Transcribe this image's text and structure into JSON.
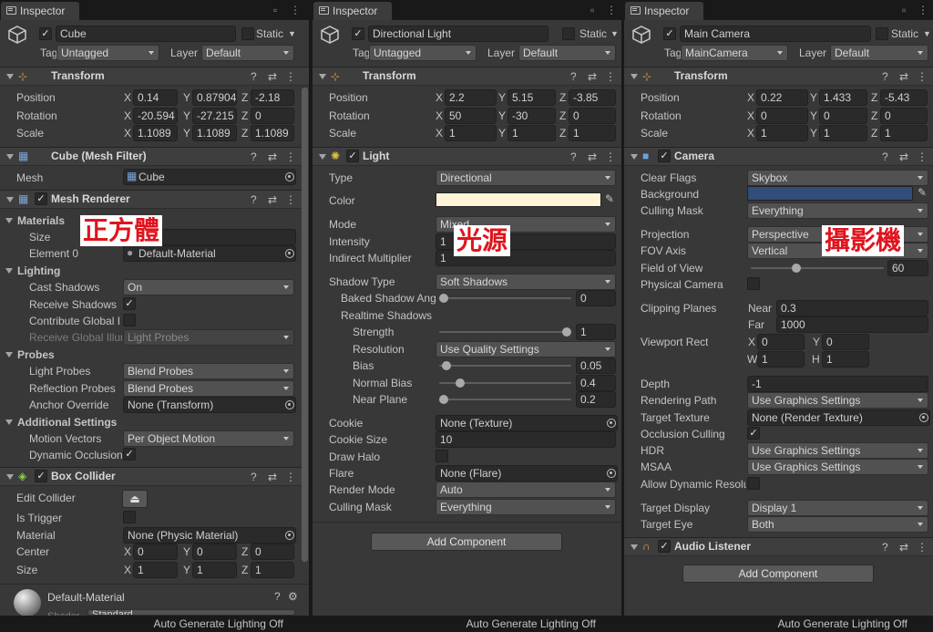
{
  "panel1": {
    "tab": "Inspector",
    "name": "Cube",
    "static_label": "Static",
    "tag_label": "Tag",
    "tag_value": "Untagged",
    "layer_label": "Layer",
    "layer_value": "Default",
    "transform": {
      "title": "Transform",
      "position_label": "Position",
      "rotation_label": "Rotation",
      "scale_label": "Scale",
      "position": [
        "0.14",
        "0.87904",
        "-2.18"
      ],
      "rotation": [
        "-20.594",
        "-27.215",
        "0"
      ],
      "scale": [
        "1.1089",
        "1.1089",
        "1.1089"
      ]
    },
    "mesh_filter": {
      "title": "Cube (Mesh Filter)",
      "mesh_label": "Mesh",
      "mesh_value": "Cube"
    },
    "mesh_renderer": {
      "title": "Mesh Renderer",
      "materials_label": "Materials",
      "size_label": "Size",
      "element0_label": "Element 0",
      "element0_value": "Default-Material",
      "lighting_label": "Lighting",
      "cast_shadows_label": "Cast Shadows",
      "cast_shadows_value": "On",
      "receive_shadows_label": "Receive Shadows",
      "contribute_gi_label": "Contribute Global Il",
      "receive_gi_label": "Receive Global Illur",
      "receive_gi_value": "Light Probes",
      "probes_label": "Probes",
      "light_probes_label": "Light Probes",
      "light_probes_value": "Blend Probes",
      "reflection_probes_label": "Reflection Probes",
      "reflection_probes_value": "Blend Probes",
      "anchor_override_label": "Anchor Override",
      "anchor_override_value": "None (Transform)",
      "additional_label": "Additional Settings",
      "motion_vectors_label": "Motion Vectors",
      "motion_vectors_value": "Per Object Motion",
      "dynamic_occlusion_label": "Dynamic Occlusion"
    },
    "box_collider": {
      "title": "Box Collider",
      "edit_collider_label": "Edit Collider",
      "is_trigger_label": "Is Trigger",
      "material_label": "Material",
      "material_value": "None (Physic Material)",
      "center_label": "Center",
      "center": [
        "0",
        "0",
        "0"
      ],
      "size_label": "Size",
      "size": [
        "1",
        "1",
        "1"
      ]
    },
    "material_preview": {
      "name": "Default-Material",
      "shader_label": "Shader",
      "shader_value": "Standard"
    },
    "overlay": "正方體",
    "footer": "Auto Generate Lighting Off"
  },
  "panel2": {
    "tab": "Inspector",
    "name": "Directional Light",
    "static_label": "Static",
    "tag_label": "Tag",
    "tag_value": "Untagged",
    "layer_label": "Layer",
    "layer_value": "Default",
    "transform": {
      "title": "Transform",
      "position_label": "Position",
      "rotation_label": "Rotation",
      "scale_label": "Scale",
      "position": [
        "2.2",
        "5.15",
        "-3.85"
      ],
      "rotation": [
        "50",
        "-30",
        "0"
      ],
      "scale": [
        "1",
        "1",
        "1"
      ]
    },
    "light": {
      "title": "Light",
      "type_label": "Type",
      "type_value": "Directional",
      "color_label": "Color",
      "color_value": "#fff4d6",
      "mode_label": "Mode",
      "mode_value": "Mixed",
      "intensity_label": "Intensity",
      "intensity_value": "1",
      "indirect_label": "Indirect Multiplier",
      "indirect_value": "1",
      "shadow_type_label": "Shadow Type",
      "shadow_type_value": "Soft Shadows",
      "baked_shadow_label": "Baked Shadow Ang",
      "baked_shadow_value": "0",
      "baked_shadow_fraction": 0.0,
      "realtime_label": "Realtime Shadows",
      "strength_label": "Strength",
      "strength_value": "1",
      "strength_fraction": 1.0,
      "resolution_label": "Resolution",
      "resolution_value": "Use Quality Settings",
      "bias_label": "Bias",
      "bias_value": "0.05",
      "bias_fraction": 0.025,
      "normal_bias_label": "Normal Bias",
      "normal_bias_value": "0.4",
      "normal_bias_fraction": 0.13,
      "near_plane_label": "Near Plane",
      "near_plane_value": "0.2",
      "near_plane_fraction": 0.0,
      "cookie_label": "Cookie",
      "cookie_value": "None (Texture)",
      "cookie_size_label": "Cookie Size",
      "cookie_size_value": "10",
      "draw_halo_label": "Draw Halo",
      "flare_label": "Flare",
      "flare_value": "None (Flare)",
      "render_mode_label": "Render Mode",
      "render_mode_value": "Auto",
      "culling_mask_label": "Culling Mask",
      "culling_mask_value": "Everything"
    },
    "add_component": "Add Component",
    "overlay": "光源",
    "footer": "Auto Generate Lighting Off"
  },
  "panel3": {
    "tab": "Inspector",
    "name": "Main Camera",
    "static_label": "Static",
    "tag_label": "Tag",
    "tag_value": "MainCamera",
    "layer_label": "Layer",
    "layer_value": "Default",
    "transform": {
      "title": "Transform",
      "position_label": "Position",
      "rotation_label": "Rotation",
      "scale_label": "Scale",
      "position": [
        "0.22",
        "1.433",
        "-5.43"
      ],
      "rotation": [
        "0",
        "0",
        "0"
      ],
      "scale": [
        "1",
        "1",
        "1"
      ]
    },
    "camera": {
      "title": "Camera",
      "clear_flags_label": "Clear Flags",
      "clear_flags_value": "Skybox",
      "background_label": "Background",
      "background_color": "#314d79",
      "culling_mask_label": "Culling Mask",
      "culling_mask_value": "Everything",
      "projection_label": "Projection",
      "projection_value": "Perspective",
      "fov_axis_label": "FOV Axis",
      "fov_axis_value": "Vertical",
      "fov_label": "Field of View",
      "fov_value": "60",
      "fov_fraction": 0.33,
      "physical_label": "Physical Camera",
      "clipping_label": "Clipping Planes",
      "near_label": "Near",
      "near_value": "0.3",
      "far_label": "Far",
      "far_value": "1000",
      "viewport_label": "Viewport Rect",
      "vx_value": "0",
      "vy_value": "0",
      "vw_value": "1",
      "vh_value": "1",
      "depth_label": "Depth",
      "depth_value": "-1",
      "rendering_path_label": "Rendering Path",
      "rendering_path_value": "Use Graphics Settings",
      "target_texture_label": "Target Texture",
      "target_texture_value": "None (Render Texture)",
      "occlusion_label": "Occlusion Culling",
      "hdr_label": "HDR",
      "hdr_value": "Use Graphics Settings",
      "msaa_label": "MSAA",
      "msaa_value": "Use Graphics Settings",
      "dyn_res_label": "Allow Dynamic Resolu",
      "target_display_label": "Target Display",
      "target_display_value": "Display 1",
      "target_eye_label": "Target Eye",
      "target_eye_value": "Both"
    },
    "audio_listener": {
      "title": "Audio Listener"
    },
    "add_component": "Add Component",
    "overlay": "攝影機",
    "footer": "Auto Generate Lighting Off"
  },
  "axes": {
    "x": "X",
    "y": "Y",
    "z": "Z",
    "w": "W",
    "h": "H"
  },
  "icons": {
    "kebab": "⋮",
    "help": "?",
    "preset": "⇄",
    "lock": "🔒",
    "check": "✓"
  }
}
